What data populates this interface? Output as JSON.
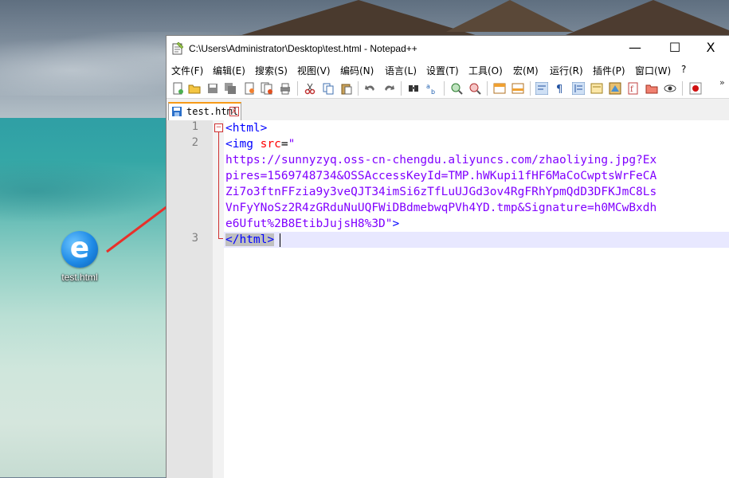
{
  "desktop": {
    "icon_label": "test.html"
  },
  "window": {
    "title": "C:\\Users\\Administrator\\Desktop\\test.html - Notepad++",
    "controls": {
      "minimize": "—",
      "maximize": "☐",
      "close": "X"
    }
  },
  "menu": {
    "items": [
      "文件(F)",
      "编辑(E)",
      "搜索(S)",
      "视图(V)",
      "编码(N)",
      "语言(L)",
      "设置(T)",
      "工具(O)",
      "宏(M)",
      "运行(R)",
      "插件(P)",
      "窗口(W)",
      "?"
    ]
  },
  "toolbar": {
    "more": "»"
  },
  "tabs": [
    {
      "label": "test.html",
      "close": "x"
    }
  ],
  "editor": {
    "line_numbers": [
      "1",
      "2",
      "3"
    ],
    "fold_marker": "−",
    "lines": {
      "l1_tag": "<html>",
      "l2_tag": "<img",
      "l2_attr": "src",
      "l2_eq": "=",
      "l2_quote_open": "\"",
      "wrap1": "https://sunnyzyq.oss-cn-chengdu.aliyuncs.com/zhaoliying.jpg?Ex",
      "wrap2": "pires=1569748734&OSSAccessKeyId=TMP.hWKupi1fHF6MaCoCwptsWrFeCA",
      "wrap3": "Zi7o3ftnFFzia9y3veQJT34imSi6zTfLuUJGd3ov4RgFRhYpmQdD3DFKJmC8Ls",
      "wrap4": "VnFyYNoSz2R4zGRduNuUQFWiDBdmebwqPVh4YD.tmp&Signature=h0MCwBxdh",
      "wrap5": "e6Ufut%2B8EtibJujsH8%3D\"",
      "wrap5_tag": ">",
      "l3_tag": "</html>"
    }
  },
  "colors": {
    "tag": "#0000ff",
    "attribute": "#ff0000",
    "string": "#8000ff",
    "annotation_arrow": "#e8302a"
  }
}
